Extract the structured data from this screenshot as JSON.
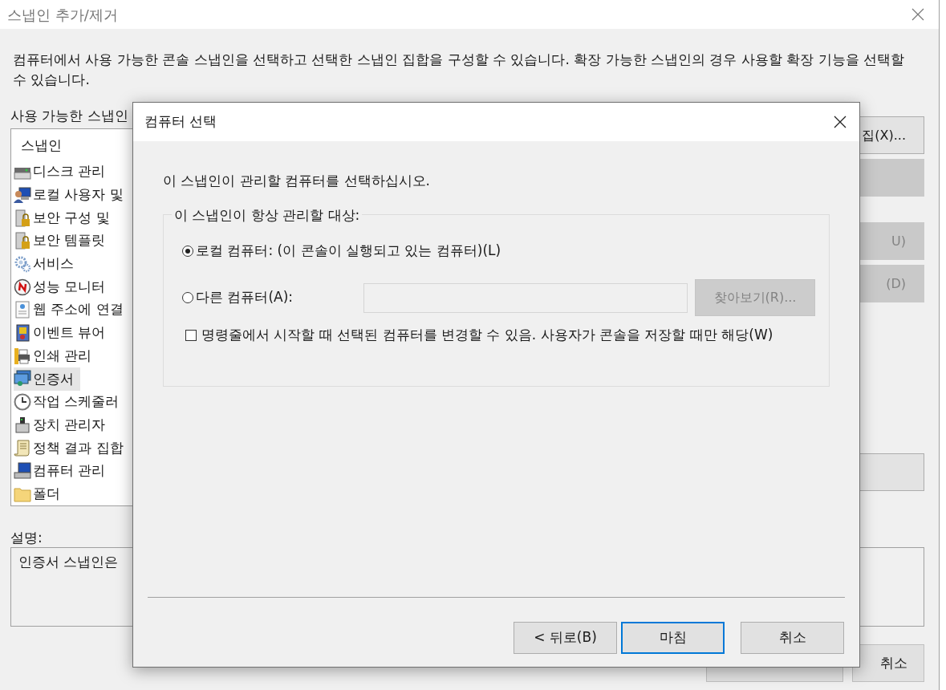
{
  "window": {
    "title": "스냅인 추가/제거"
  },
  "intro": "컴퓨터에서 사용 가능한 콘솔 스냅인을 선택하고 선택한 스냅인 집합을 구성할 수 있습니다. 확장 가능한 스냅인의 경우 사용할 확장 기능을 선택할 수 있습니다.",
  "available": {
    "label": "사용 가능한 스냅인",
    "column": "스냅인",
    "items": [
      {
        "label": "디스크 관리",
        "selected": false
      },
      {
        "label": "로컬 사용자 및",
        "selected": false
      },
      {
        "label": "보안 구성 및",
        "selected": false
      },
      {
        "label": "보안 템플릿",
        "selected": false
      },
      {
        "label": "서비스",
        "selected": false
      },
      {
        "label": "성능 모니터",
        "selected": false
      },
      {
        "label": "웹 주소에 연결",
        "selected": false
      },
      {
        "label": "이벤트 뷰어",
        "selected": false
      },
      {
        "label": "인쇄 관리",
        "selected": false
      },
      {
        "label": "인증서",
        "selected": true
      },
      {
        "label": "작업 스케줄러",
        "selected": false
      },
      {
        "label": "장치 관리자",
        "selected": false
      },
      {
        "label": "정책 결과 집합",
        "selected": false
      },
      {
        "label": "컴퓨터 관리",
        "selected": false
      },
      {
        "label": "폴더",
        "selected": false
      }
    ]
  },
  "side_buttons": [
    {
      "label": "집(X)...",
      "disabled": false
    },
    {
      "disabled": true
    },
    {
      "label": "U)",
      "disabled": true
    },
    {
      "label": "(D)",
      "disabled": true
    },
    {
      "disabled": false
    }
  ],
  "description": {
    "label": "설명:",
    "text": "인증서 스냅인은"
  },
  "bottom_buttons": [
    {
      "disabled": false
    },
    {
      "label": "취소",
      "disabled": false
    }
  ],
  "dialog": {
    "title": "컴퓨터 선택",
    "prompt": "이 스냅인이 관리할 컴퓨터를 선택하십시오.",
    "group": {
      "legend": "이 스냅인이 항상 관리할 대상:",
      "options": [
        {
          "label": "로컬 컴퓨터: (이 콘솔이 실행되고 있는 컴퓨터)(L)",
          "selected": true
        },
        {
          "label": "다른 컴퓨터(A):",
          "selected": false
        }
      ],
      "browse": {
        "label": "찾아보기(R)...",
        "disabled": true
      },
      "checkbox": {
        "label": "명령줄에서 시작할 때 선택된 컴퓨터를 변경할 수 있음. 사용자가 콘솔을 저장할 때만 해당(W)",
        "checked": false
      }
    },
    "buttons": [
      {
        "label": "< 뒤로(B)",
        "focused": false
      },
      {
        "label": "마침",
        "focused": true
      },
      {
        "label": "취소",
        "focused": false
      }
    ]
  }
}
